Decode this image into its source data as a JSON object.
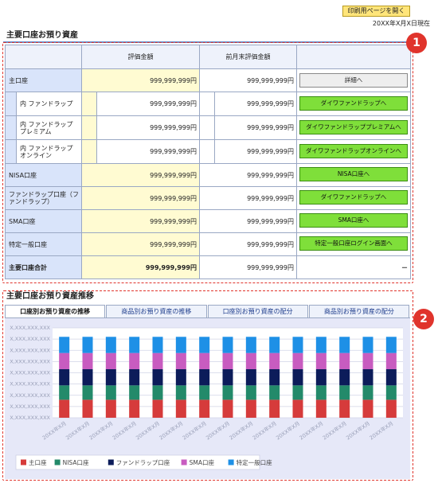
{
  "header": {
    "print_label": "印刷用ページを開く",
    "asof": "20XX年X月X日現在"
  },
  "section1": {
    "title": "主要口座お預り資産",
    "columns": [
      "",
      "評価金額",
      "前月末評価金額",
      ""
    ],
    "rows": {
      "main": {
        "label": "主口座",
        "value": "999,999,999円",
        "prev": "999,999,999円",
        "button": "詳細へ"
      },
      "fw": {
        "label": "内 ファンドラップ",
        "value": "999,999,999円",
        "prev": "999,999,999円",
        "button": "ダイワファンドラップへ"
      },
      "fwp": {
        "label": "内 ファンドラッププレミアム",
        "value": "999,999,999円",
        "prev": "999,999,999円",
        "button": "ダイワファンドラッププレミアムへ"
      },
      "fwo": {
        "label": "内 ファンドラップオンライン",
        "value": "999,999,999円",
        "prev": "999,999,999円",
        "button": "ダイワファンドラップオンラインへ"
      },
      "nisa": {
        "label": "NISA口座",
        "value": "999,999,999円",
        "prev": "999,999,999円",
        "button": "NISA口座へ"
      },
      "fund": {
        "label": "ファンドラップ口座（ファンドラップ）",
        "value": "999,999,999円",
        "prev": "999,999,999円",
        "button": "ダイワファンドラップへ"
      },
      "sma": {
        "label": "SMA口座",
        "value": "999,999,999円",
        "prev": "999,999,999円",
        "button": "SMA口座へ"
      },
      "tokutei": {
        "label": "特定一般口座",
        "value": "999,999,999円",
        "prev": "999,999,999円",
        "button": "特定一般口座ログイン画面へ"
      },
      "total": {
        "label": "主要口座合計",
        "value": "999,999,999円",
        "prev": "999,999,999円",
        "dash": "－"
      }
    }
  },
  "section2": {
    "title": "主要口座お預り資産推移",
    "tabs": [
      "口座別お預り資産の推移",
      "商品別お預り資産の推移",
      "口座別お預り資産の配分",
      "商品別お預り資産の配分"
    ]
  },
  "chart_data": {
    "type": "bar",
    "stacked": true,
    "categories": [
      "20XX年X月",
      "20XX年X月",
      "20XX年X月",
      "20XX年X月",
      "20XX年X月",
      "20XX年X月",
      "20XX年X月",
      "20XX年X月",
      "20XX年X月",
      "20XX年X月",
      "20XX年X月",
      "20XX年X月",
      "20XX年X月",
      "20XX年X月",
      "20XX年X月"
    ],
    "y_tick_labels": [
      "X,XXX,XXX,XXX",
      "X,XXX,XXX,XXX",
      "X,XXX,XXX,XXX",
      "X,XXX,XXX,XXX",
      "X,XXX,XXX,XXX",
      "X,XXX,XXX,XXX",
      "X,XXX,XXX,XXX",
      "X,XXX,XXX,XXX",
      "X,XXX,XXX,XXX"
    ],
    "series": [
      {
        "name": "主口座",
        "color": "#d63b3b",
        "values": [
          20,
          20,
          20,
          20,
          20,
          20,
          20,
          20,
          20,
          20,
          20,
          20,
          20,
          20,
          20
        ]
      },
      {
        "name": "NISA口座",
        "color": "#238a6a",
        "values": [
          16,
          16,
          16,
          16,
          16,
          16,
          16,
          16,
          16,
          16,
          16,
          16,
          16,
          16,
          16
        ]
      },
      {
        "name": "ファンドラップ口座",
        "color": "#0c1c5a",
        "values": [
          18,
          18,
          18,
          18,
          18,
          18,
          18,
          18,
          18,
          18,
          18,
          18,
          18,
          18,
          18
        ]
      },
      {
        "name": "SMA口座",
        "color": "#c85cc0",
        "values": [
          18,
          18,
          18,
          18,
          18,
          18,
          18,
          18,
          18,
          18,
          18,
          18,
          18,
          18,
          18
        ]
      },
      {
        "name": "特定一般口座",
        "color": "#1e90e6",
        "values": [
          18,
          18,
          18,
          18,
          18,
          18,
          18,
          18,
          18,
          18,
          18,
          18,
          18,
          18,
          18
        ]
      }
    ],
    "grid": true,
    "legend": "bottom-left"
  }
}
